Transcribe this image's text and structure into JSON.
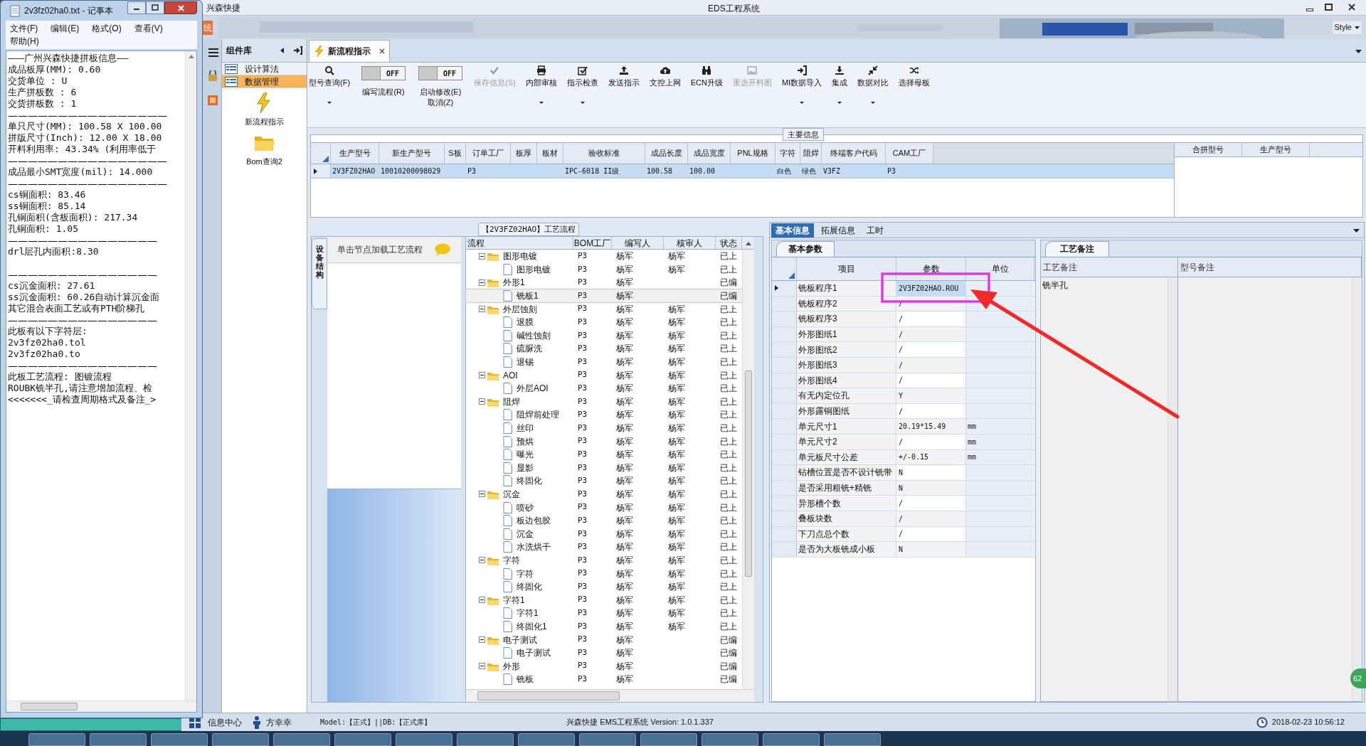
{
  "notepad": {
    "title": "2v3fz02ha0.txt - 记事本",
    "menu": [
      "文件(F)",
      "编辑(E)",
      "格式(O)",
      "查看(V)",
      "帮助(H)"
    ],
    "lines": [
      {
        "kind": "text",
        "text": "———广州兴森快捷拼板信息——"
      },
      {
        "kind": "text",
        "text": "成品板厚(MM): 0.60"
      },
      {
        "kind": "text",
        "text": "交货单位 : U"
      },
      {
        "kind": "text",
        "text": "生产拼板数 : 6"
      },
      {
        "kind": "text",
        "text": "交货拼板数 : 1"
      },
      {
        "kind": "rule",
        "text": "————————————————"
      },
      {
        "kind": "text",
        "text": "单只尺寸(MM): 100.58 X 100.00"
      },
      {
        "kind": "text",
        "text": "拼版尺寸(Inch): 12.00 X 18.00"
      },
      {
        "kind": "text",
        "text": "开料利用率: 43.34% (利用率低于"
      },
      {
        "kind": "rule",
        "text": "————————————————"
      },
      {
        "kind": "text",
        "text": "成品最小SMT宽度(mil): 14.000"
      },
      {
        "kind": "rule",
        "text": "————————————————"
      },
      {
        "kind": "text",
        "text": "cs铜面积: 83.46"
      },
      {
        "kind": "text",
        "text": "ss铜面积: 85.14"
      },
      {
        "kind": "text",
        "text": "孔铜面积(含板面积): 217.34"
      },
      {
        "kind": "text",
        "text": "孔铜面积: 1.05"
      },
      {
        "kind": "rule",
        "text": "———————————————"
      },
      {
        "kind": "text",
        "text": "drl层孔内面积:8.30"
      },
      {
        "kind": "blank"
      },
      {
        "kind": "rule",
        "text": "———————————————"
      },
      {
        "kind": "text",
        "text": "cs沉金面积: 27.61"
      },
      {
        "kind": "text",
        "text": "ss沉金面积: 60.26自动计算沉金面"
      },
      {
        "kind": "text",
        "text": "其它混合表面工艺或有PTH阶梯孔"
      },
      {
        "kind": "rule",
        "text": "———————————————"
      },
      {
        "kind": "text",
        "text": "此板有以下字符层:"
      },
      {
        "kind": "text",
        "text": "2v3fz02ha0.tol"
      },
      {
        "kind": "text",
        "text": "2v3fz02ha0.to"
      },
      {
        "kind": "rule",
        "text": "———————————————"
      },
      {
        "kind": "text",
        "text": "此板工艺流程: 图镀流程"
      },
      {
        "kind": "text",
        "text": "ROUBK铣半孔,请注意增加流程、检"
      },
      {
        "kind": "text",
        "text": "<<<<<<<_请检查周期格式及备注_>"
      }
    ]
  },
  "app": {
    "brand": "兴森快捷",
    "title": "EDS工程系统",
    "menu_tab": "统",
    "style_menu": "Style"
  },
  "component_library": {
    "title": "组件库",
    "items": [
      {
        "label": "设计算法",
        "selected": false
      },
      {
        "label": "数据管理",
        "selected": true
      }
    ],
    "tools": [
      "新流程指示",
      "Bom查询2"
    ]
  },
  "doc_tabs": [
    {
      "label": "新流程指示",
      "selected": true
    }
  ],
  "toolbar": [
    {
      "kind": "button",
      "label": "型号查询(F)",
      "dropdown": true,
      "disabled": false
    },
    {
      "kind": "toggle",
      "label": "编写流程(R)",
      "switch_text": "OFF",
      "on": false
    },
    {
      "kind": "toggle",
      "label": "启动修改(E)",
      "second_line": "取消(Z)",
      "switch_text": "OFF",
      "on": false
    },
    {
      "kind": "button",
      "label": "保存信息(S)",
      "dropdown": false,
      "disabled": true
    },
    {
      "kind": "button",
      "label": "内部审核",
      "dropdown": true,
      "disabled": false
    },
    {
      "kind": "button",
      "label": "指示检查",
      "dropdown": true,
      "disabled": false
    },
    {
      "kind": "button",
      "label": "发送指示",
      "dropdown": false,
      "disabled": false
    },
    {
      "kind": "button",
      "label": "文控上网",
      "dropdown": false,
      "disabled": false
    },
    {
      "kind": "button",
      "label": "ECN升级",
      "dropdown": false,
      "disabled": false
    },
    {
      "kind": "button",
      "label": "重选开料图",
      "dropdown": false,
      "disabled": true
    },
    {
      "kind": "button",
      "label": "MI数据导入",
      "dropdown": true,
      "disabled": false
    },
    {
      "kind": "button",
      "label": "集成",
      "dropdown": true,
      "disabled": false
    },
    {
      "kind": "button",
      "label": "数据对比",
      "dropdown": true,
      "disabled": false
    },
    {
      "kind": "button",
      "label": "选择母板",
      "dropdown": false,
      "disabled": false
    }
  ],
  "main_info": {
    "title": "主要信息",
    "columns": [
      "生产型号",
      "新生产型号",
      "S板",
      "订单工厂",
      "板厚",
      "板材",
      "验收标准",
      "成品长度",
      "成品宽度",
      "PNL规格",
      "字符",
      "阻焊",
      "终端客户代码",
      "CAM工厂"
    ],
    "rows": [
      {
        "selected": true,
        "cells": [
          "2V3FZ02HAO",
          "10010200098029",
          null,
          "P3",
          null,
          null,
          "IPC-6018 II级",
          "100.58",
          "100.00",
          null,
          "白色",
          "绿色",
          "V3FZ",
          "P3"
        ]
      }
    ],
    "merge_columns": [
      "合拼型号",
      "生产型号"
    ]
  },
  "process_flow": {
    "title": "【2V3FZ02HAO】工艺流程",
    "side_tab": "设备结构",
    "hint": "单击节点加载工艺流程",
    "columns": [
      "流程",
      "BOM工厂",
      "编写人",
      "核审人",
      "状态"
    ],
    "tree": [
      {
        "kind": "folder",
        "label": "图形电镀",
        "expanded": true,
        "bom": "P3",
        "writer": "杨军",
        "reviewer": "杨军",
        "status": "已上",
        "selected": false,
        "children": [
          {
            "kind": "file",
            "label": "图形电镀",
            "bom": "P3",
            "writer": "杨军",
            "reviewer": "杨军",
            "status": "已上",
            "selected": false
          }
        ]
      },
      {
        "kind": "folder",
        "label": "外形1",
        "expanded": true,
        "bom": "P3",
        "writer": "杨军",
        "status": "已编",
        "selected": false,
        "children": [
          {
            "kind": "file",
            "label": "铣板1",
            "bom": "P3",
            "writer": "杨军",
            "status": "已编",
            "selected": true
          }
        ]
      },
      {
        "kind": "folder",
        "label": "外层蚀刻",
        "expanded": true,
        "bom": "P3",
        "writer": "杨军",
        "reviewer": "杨军",
        "status": "已上",
        "selected": false,
        "children": [
          {
            "kind": "file",
            "label": "退膜",
            "bom": "P3",
            "writer": "杨军",
            "reviewer": "杨军",
            "status": "已上",
            "selected": false
          },
          {
            "kind": "file",
            "label": "碱性蚀刻",
            "bom": "P3",
            "writer": "杨军",
            "reviewer": "杨军",
            "status": "已上",
            "selected": false
          },
          {
            "kind": "file",
            "label": "硫脲洗",
            "bom": "P3",
            "writer": "杨军",
            "reviewer": "杨军",
            "status": "已上",
            "selected": false
          },
          {
            "kind": "file",
            "label": "退锡",
            "bom": "P3",
            "writer": "杨军",
            "reviewer": "杨军",
            "status": "已上",
            "selected": false
          }
        ]
      },
      {
        "kind": "folder",
        "label": "AOI",
        "expanded": true,
        "bom": "P3",
        "writer": "杨军",
        "reviewer": "杨军",
        "status": "已上",
        "selected": false,
        "children": [
          {
            "kind": "file",
            "label": "外层AOI",
            "bom": "P3",
            "writer": "杨军",
            "reviewer": "杨军",
            "status": "已上",
            "selected": false
          }
        ]
      },
      {
        "kind": "folder",
        "label": "阻焊",
        "expanded": true,
        "bom": "P3",
        "writer": "杨军",
        "reviewer": "杨军",
        "status": "已上",
        "selected": false,
        "children": [
          {
            "kind": "file",
            "label": "阻焊前处理",
            "bom": "P3",
            "writer": "杨军",
            "reviewer": "杨军",
            "status": "已上",
            "selected": false
          },
          {
            "kind": "file",
            "label": "丝印",
            "bom": "P3",
            "writer": "杨军",
            "reviewer": "杨军",
            "status": "已上",
            "selected": false
          },
          {
            "kind": "file",
            "label": "预烘",
            "bom": "P3",
            "writer": "杨军",
            "reviewer": "杨军",
            "status": "已上",
            "selected": false
          },
          {
            "kind": "file",
            "label": "曝光",
            "bom": "P3",
            "writer": "杨军",
            "reviewer": "杨军",
            "status": "已上",
            "selected": false
          },
          {
            "kind": "file",
            "label": "显影",
            "bom": "P3",
            "writer": "杨军",
            "reviewer": "杨军",
            "status": "已上",
            "selected": false
          },
          {
            "kind": "file",
            "label": "终固化",
            "bom": "P3",
            "writer": "杨军",
            "reviewer": "杨军",
            "status": "已上",
            "selected": false
          }
        ]
      },
      {
        "kind": "folder",
        "label": "沉金",
        "expanded": true,
        "bom": "P3",
        "writer": "杨军",
        "reviewer": "杨军",
        "status": "已上",
        "selected": false,
        "children": [
          {
            "kind": "file",
            "label": "喷砂",
            "bom": "P3",
            "writer": "杨军",
            "reviewer": "杨军",
            "status": "已上",
            "selected": false
          },
          {
            "kind": "file",
            "label": "板边包胶",
            "bom": "P3",
            "writer": "杨军",
            "reviewer": "杨军",
            "status": "已上",
            "selected": false
          },
          {
            "kind": "file",
            "label": "沉金",
            "bom": "P3",
            "writer": "杨军",
            "reviewer": "杨军",
            "status": "已上",
            "selected": false
          },
          {
            "kind": "file",
            "label": "水洗烘干",
            "bom": "P3",
            "writer": "杨军",
            "reviewer": "杨军",
            "status": "已上",
            "selected": false
          }
        ]
      },
      {
        "kind": "folder",
        "label": "字符",
        "expanded": true,
        "bom": "P3",
        "writer": "杨军",
        "reviewer": "杨军",
        "status": "已上",
        "selected": false,
        "children": [
          {
            "kind": "file",
            "label": "字符",
            "bom": "P3",
            "writer": "杨军",
            "reviewer": "杨军",
            "status": "已上",
            "selected": false
          },
          {
            "kind": "file",
            "label": "终固化",
            "bom": "P3",
            "writer": "杨军",
            "reviewer": "杨军",
            "status": "已上",
            "selected": false
          }
        ]
      },
      {
        "kind": "folder",
        "label": "字符1",
        "expanded": true,
        "bom": "P3",
        "writer": "杨军",
        "reviewer": "杨军",
        "status": "已上",
        "selected": false,
        "children": [
          {
            "kind": "file",
            "label": "字符1",
            "bom": "P3",
            "writer": "杨军",
            "reviewer": "杨军",
            "status": "已上",
            "selected": false
          },
          {
            "kind": "file",
            "label": "终固化1",
            "bom": "P3",
            "writer": "杨军",
            "reviewer": "杨军",
            "status": "已上",
            "selected": false
          }
        ]
      },
      {
        "kind": "folder",
        "label": "电子测试",
        "expanded": true,
        "bom": "P3",
        "writer": "杨军",
        "status": "已编",
        "selected": false,
        "children": [
          {
            "kind": "file",
            "label": "电子测试",
            "bom": "P3",
            "writer": "杨军",
            "status": "已编",
            "selected": false
          }
        ]
      },
      {
        "kind": "folder",
        "label": "外形",
        "expanded": true,
        "bom": "P3",
        "writer": "杨军",
        "status": "已编",
        "selected": false,
        "children": [
          {
            "kind": "file",
            "label": "铣板",
            "bom": "P3",
            "writer": "杨军",
            "status": "已编",
            "selected": false
          }
        ]
      }
    ]
  },
  "detail": {
    "tabs": [
      {
        "label": "基本信息",
        "selected": true
      },
      {
        "label": "拓展信息",
        "selected": false
      },
      {
        "label": "工时",
        "selected": false
      }
    ],
    "params": {
      "tab": "基本参数",
      "columns": [
        "项目",
        "参数",
        "单位"
      ],
      "rows": [
        {
          "item": "铣板程序1",
          "value": "2V3FZ02HAO.ROU",
          "selected": true
        },
        {
          "item": "铣板程序2",
          "value": "/",
          "selected": false
        },
        {
          "item": "铣板程序3",
          "value": "/",
          "selected": false
        },
        {
          "item": "外形图纸1",
          "value": "/",
          "selected": false
        },
        {
          "item": "外形图纸2",
          "value": "/",
          "selected": false
        },
        {
          "item": "外形图纸3",
          "value": "/",
          "selected": false
        },
        {
          "item": "外形图纸4",
          "value": "/",
          "selected": false
        },
        {
          "item": "有无内定位孔",
          "value": "Y",
          "selected": false
        },
        {
          "item": "外形露铜图纸",
          "value": "/",
          "selected": false
        },
        {
          "item": "单元尺寸1",
          "value": "20.19*15.49",
          "unit": "mm",
          "selected": false
        },
        {
          "item": "单元尺寸2",
          "value": "/",
          "unit": "mm",
          "selected": false
        },
        {
          "item": "单元板尺寸公差",
          "value": "+/-0.15",
          "unit": "mm",
          "selected": false
        },
        {
          "item": "钻槽位置是否不设计铣带",
          "value": "N",
          "selected": false
        },
        {
          "item": "是否采用粗铣+精铣",
          "value": "N",
          "selected": false
        },
        {
          "item": "异形槽个数",
          "value": "/",
          "selected": false
        },
        {
          "item": "叠板块数",
          "value": "/",
          "selected": false
        },
        {
          "item": "下刀点总个数",
          "value": "/",
          "selected": false
        },
        {
          "item": "是否为大板铣成小板",
          "value": "N",
          "selected": false
        }
      ]
    },
    "notes": {
      "tab": "工艺备注",
      "columns": [
        "工艺备注",
        "型号备注"
      ],
      "process_note": "铣半孔"
    }
  },
  "status_bar": {
    "info_center": "信息中心",
    "user": "方幸幸",
    "model": "Model:【正式】||DB:【正式库】",
    "version": "兴森快捷 EMS工程系统 Version: 1.0.1.337",
    "datetime": "2018-02-23 10:56:12"
  },
  "badge": "62"
}
